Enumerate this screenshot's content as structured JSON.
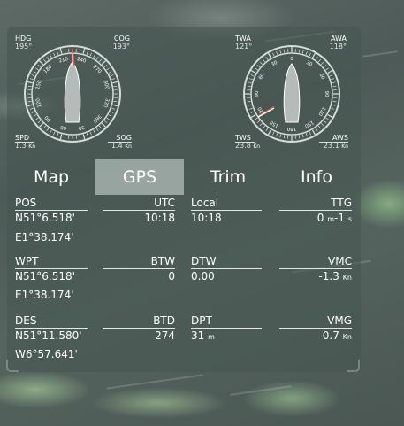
{
  "gauge_left": {
    "tl_label": "HDG",
    "tl_value": "195°",
    "tr_label": "COG",
    "tr_value": "193°",
    "bl_label": "SPD",
    "bl_value": "1.3",
    "bl_unit": "Kn",
    "br_label": "SOG",
    "br_value": "1.4",
    "br_unit": "Kn",
    "dial_numbers": [
      "210",
      "240",
      "270",
      "300",
      "330",
      "360",
      "30",
      "60",
      "90",
      "120",
      "150",
      "180"
    ]
  },
  "gauge_right": {
    "tl_label": "TWA",
    "tl_value": "121°",
    "tr_label": "AWA",
    "tr_value": "118°",
    "bl_label": "TWS",
    "bl_value": "23.8",
    "bl_unit": "Kn",
    "br_label": "AWS",
    "br_value": "23.1",
    "br_unit": "Kn",
    "dial_numbers": [
      "0",
      "30",
      "60",
      "90",
      "120",
      "150",
      "180",
      "150",
      "120",
      "90",
      "60",
      "30"
    ]
  },
  "tabs": [
    {
      "label": "Map"
    },
    {
      "label": "GPS"
    },
    {
      "label": "Trim"
    },
    {
      "label": "Info"
    }
  ],
  "active_tab": "GPS",
  "gps": {
    "row1": {
      "pos_label": "POS",
      "pos_lat": "N51°6.518'",
      "pos_lon": "E1°38.174'",
      "utc_label": "UTC",
      "utc_value": "10:18",
      "local_label": "Local",
      "local_value": "10:18",
      "ttg_label": "TTG",
      "ttg_value": "0",
      "ttg_unit_m": "m",
      "ttg_value2": "-1",
      "ttg_unit_s": "s"
    },
    "row2": {
      "wpt_label": "WPT",
      "wpt_lat": "N51°6.518'",
      "wpt_lon": "E1°38.174'",
      "btw_label": "BTW",
      "btw_value": "0",
      "dtw_label": "DTW",
      "dtw_value": "0.00",
      "vmc_label": "VMC",
      "vmc_value": "-1.3",
      "vmc_unit": "Kn"
    },
    "row3": {
      "des_label": "DES",
      "des_lat": "N51°11.580'",
      "des_lon": "W6°57.641'",
      "btd_label": "BTD",
      "btd_value": "274",
      "dpt_label": "DPT",
      "dpt_value": "31",
      "dpt_unit": "m",
      "vmg_label": "VMG",
      "vmg_value": "0.7",
      "vmg_unit": "Kn"
    }
  },
  "colors": {
    "active_tab": "#a5b2ae",
    "panel": "#46554f",
    "text": "#ffffff"
  }
}
